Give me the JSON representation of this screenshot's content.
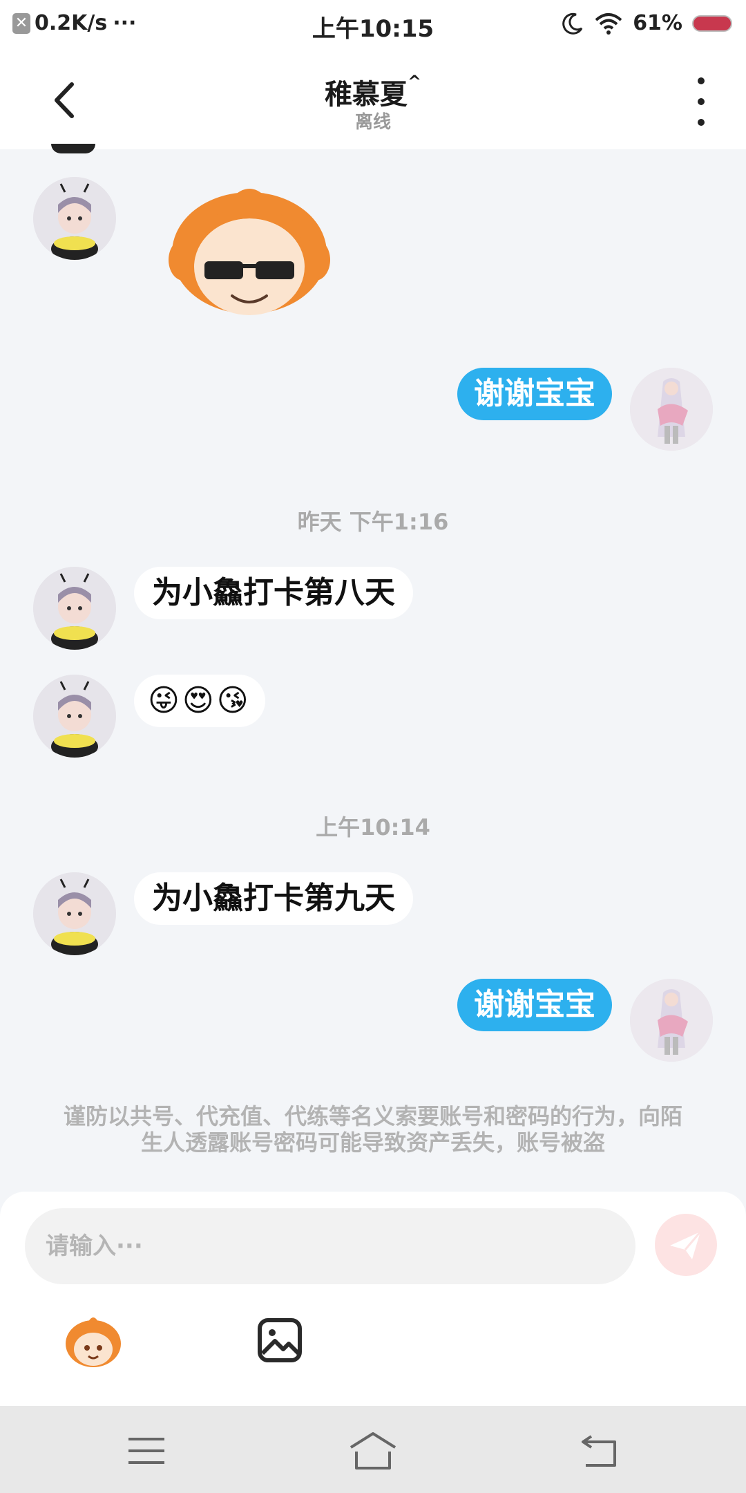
{
  "status_bar": {
    "network_speed": "0.2K/s",
    "dots": "···",
    "time": "上午10:15",
    "battery_percent": "61%",
    "icons": [
      "close-icon",
      "moon-icon",
      "wifi-icon",
      "battery-icon"
    ]
  },
  "header": {
    "title": "稚慕夏",
    "title_mark": "^",
    "status": "离线"
  },
  "messages": {
    "m1_sticker": "sunglasses-character-sticker",
    "m2_text": "谢谢宝宝",
    "ts1": "昨天 下午1:16",
    "m3_text": "为小鱻打卡第八天",
    "m4_text": "😜😍😘",
    "ts2": "上午10:14",
    "m5_text": "为小鱻打卡第九天",
    "m6_text": "谢谢宝宝"
  },
  "warning": "谨防以共号、代充值、代练等名义索要账号和密码的行为，向陌生人透露账号密码可能导致资产丢失，账号被盗",
  "input": {
    "placeholder": "请输入···"
  },
  "colors": {
    "accent_blue": "#2db0ee",
    "send_disabled": "#fde3e3",
    "background": "#f3f5f8"
  }
}
